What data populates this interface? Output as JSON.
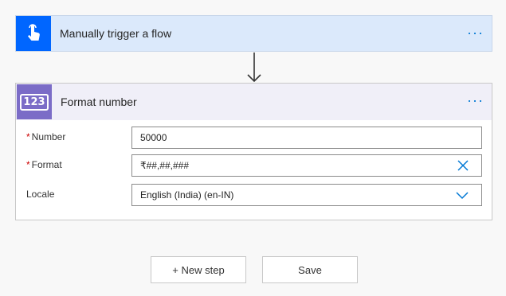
{
  "trigger": {
    "title": "Manually trigger a flow",
    "more": "···"
  },
  "action": {
    "icon_text": "123",
    "title": "Format number",
    "more": "···",
    "fields": {
      "number": {
        "required": "*",
        "label": "Number",
        "value": "50000"
      },
      "format": {
        "required": "*",
        "label": "Format",
        "value": "₹##,##,###"
      },
      "locale": {
        "label": "Locale",
        "value": "English (India) (en-IN)"
      }
    }
  },
  "buttons": {
    "new_step": "+ New step",
    "save": "Save"
  },
  "colors": {
    "trigger_accent": "#0066ff",
    "action_accent": "#7b6cc7",
    "link": "#0078d4"
  }
}
